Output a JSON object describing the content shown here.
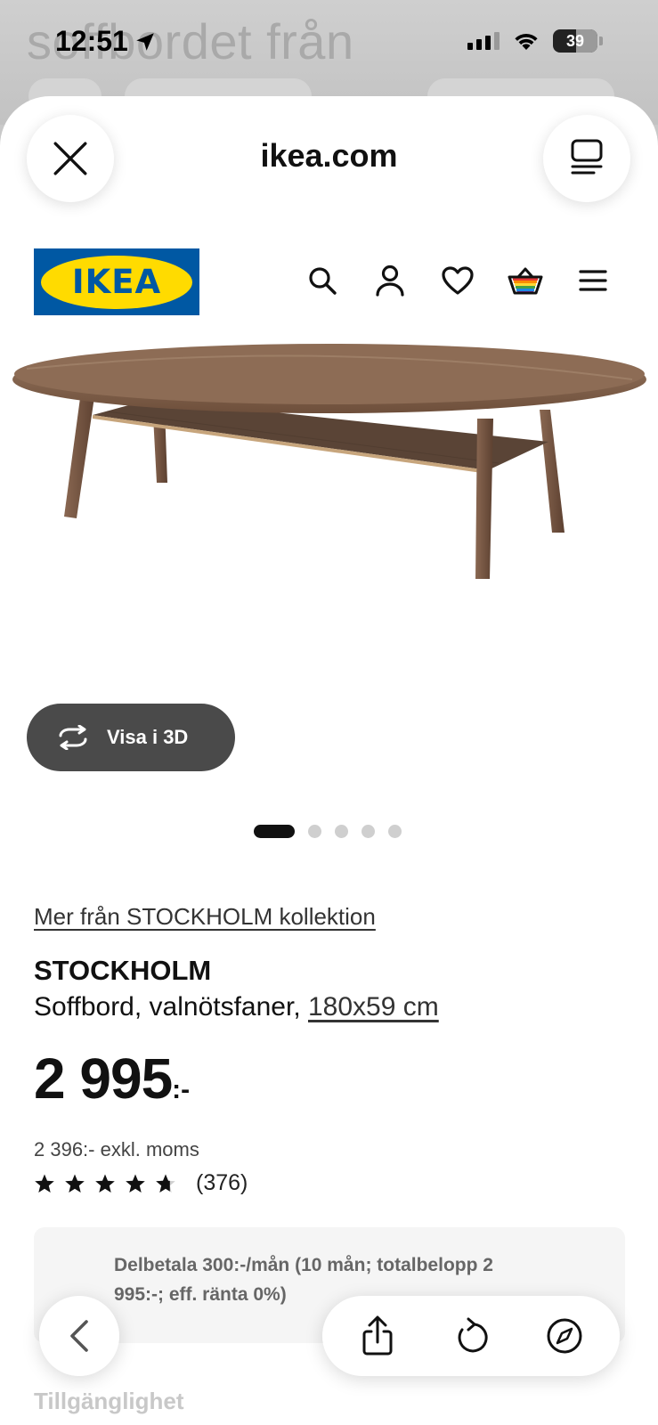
{
  "background": {
    "title_text": "soffbordet från"
  },
  "status_bar": {
    "time": "12:51",
    "battery": "39"
  },
  "browser": {
    "domain": "ikea.com"
  },
  "site": {
    "logo_text": "IKEA",
    "nav": [
      "search-icon",
      "account-icon",
      "heart-icon",
      "basket-icon",
      "menu-icon"
    ]
  },
  "product": {
    "view_3d_label": "Visa i 3D",
    "collection_link": "Mer från STOCKHOLM kollektion",
    "name": "STOCKHOLM",
    "description": "Soffbord, valnötsfaner,",
    "size": "180x59 cm",
    "price": "2 995",
    "price_suffix": ":-",
    "price_excl_vat": "2 396:- exkl. moms",
    "rating": 4.7,
    "review_count": "(376)",
    "payment_text": "Delbetala 300:-/mån (10 mån; totalbelopp 2 995:-; eff. ränta 0%)",
    "availability_heading": "Tillgänglighet",
    "image_count": 5,
    "active_image": 1
  },
  "colors": {
    "ikea_blue": "#0058a3",
    "ikea_yellow": "#ffdb00",
    "wood": "#7a5a44"
  }
}
